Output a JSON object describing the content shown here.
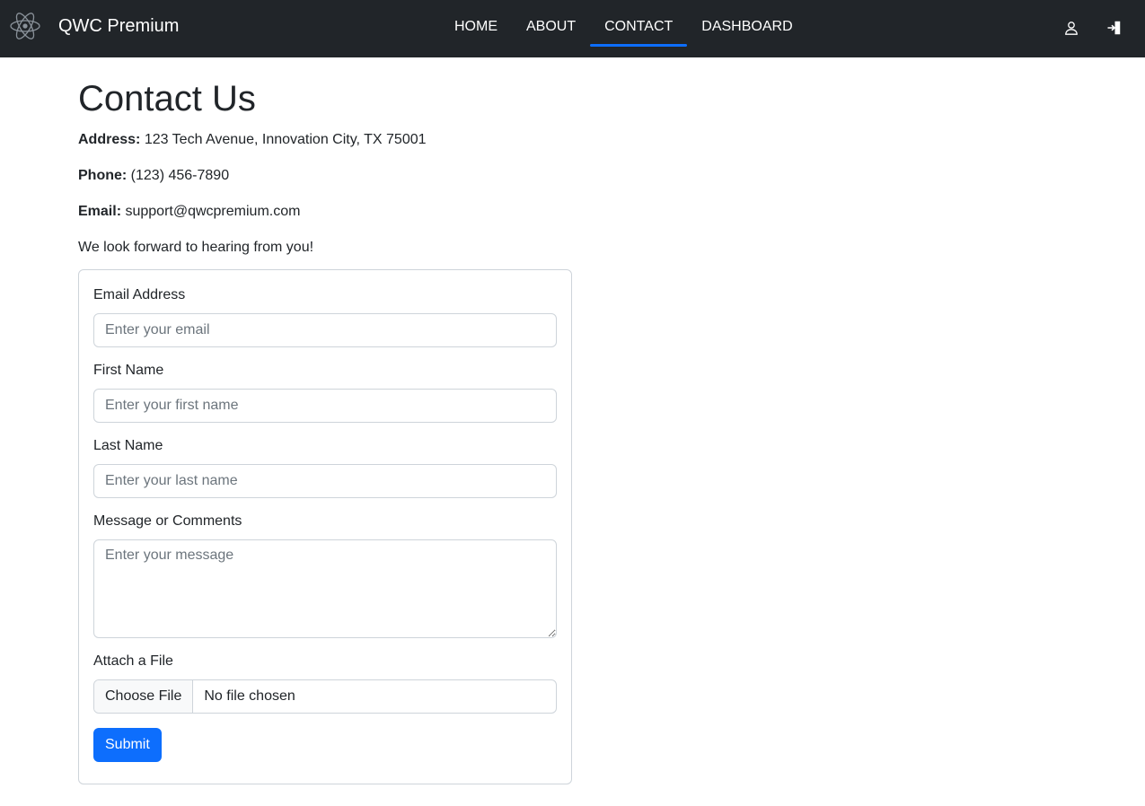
{
  "brand": {
    "name": "QWC Premium",
    "logo_icon": "atom-logo-icon"
  },
  "nav": {
    "links": [
      {
        "label": "HOME"
      },
      {
        "label": "ABOUT"
      },
      {
        "label": "CONTACT",
        "active": true
      },
      {
        "label": "DASHBOARD"
      }
    ],
    "user_icon": "user-icon",
    "logout_icon": "logout-icon",
    "active_color": "#0d6efd"
  },
  "page": {
    "title": "Contact Us",
    "address_label": "Address:",
    "address_value": "123 Tech Avenue, Innovation City, TX 75001",
    "phone_label": "Phone:",
    "phone_value": "(123) 456-7890",
    "email_label": "Email:",
    "email_value": "support@qwcpremium.com",
    "closing": "We look forward to hearing from you!"
  },
  "form": {
    "email": {
      "label": "Email Address",
      "placeholder": "Enter your email"
    },
    "first_name": {
      "label": "First Name",
      "placeholder": "Enter your first name"
    },
    "last_name": {
      "label": "Last Name",
      "placeholder": "Enter your last name"
    },
    "message": {
      "label": "Message or Comments",
      "placeholder": "Enter your message"
    },
    "file": {
      "label": "Attach a File",
      "button": "Choose File",
      "status": "No file chosen"
    },
    "submit_label": "Submit"
  },
  "colors": {
    "navbar_bg": "#212529",
    "primary": "#0d6efd"
  }
}
